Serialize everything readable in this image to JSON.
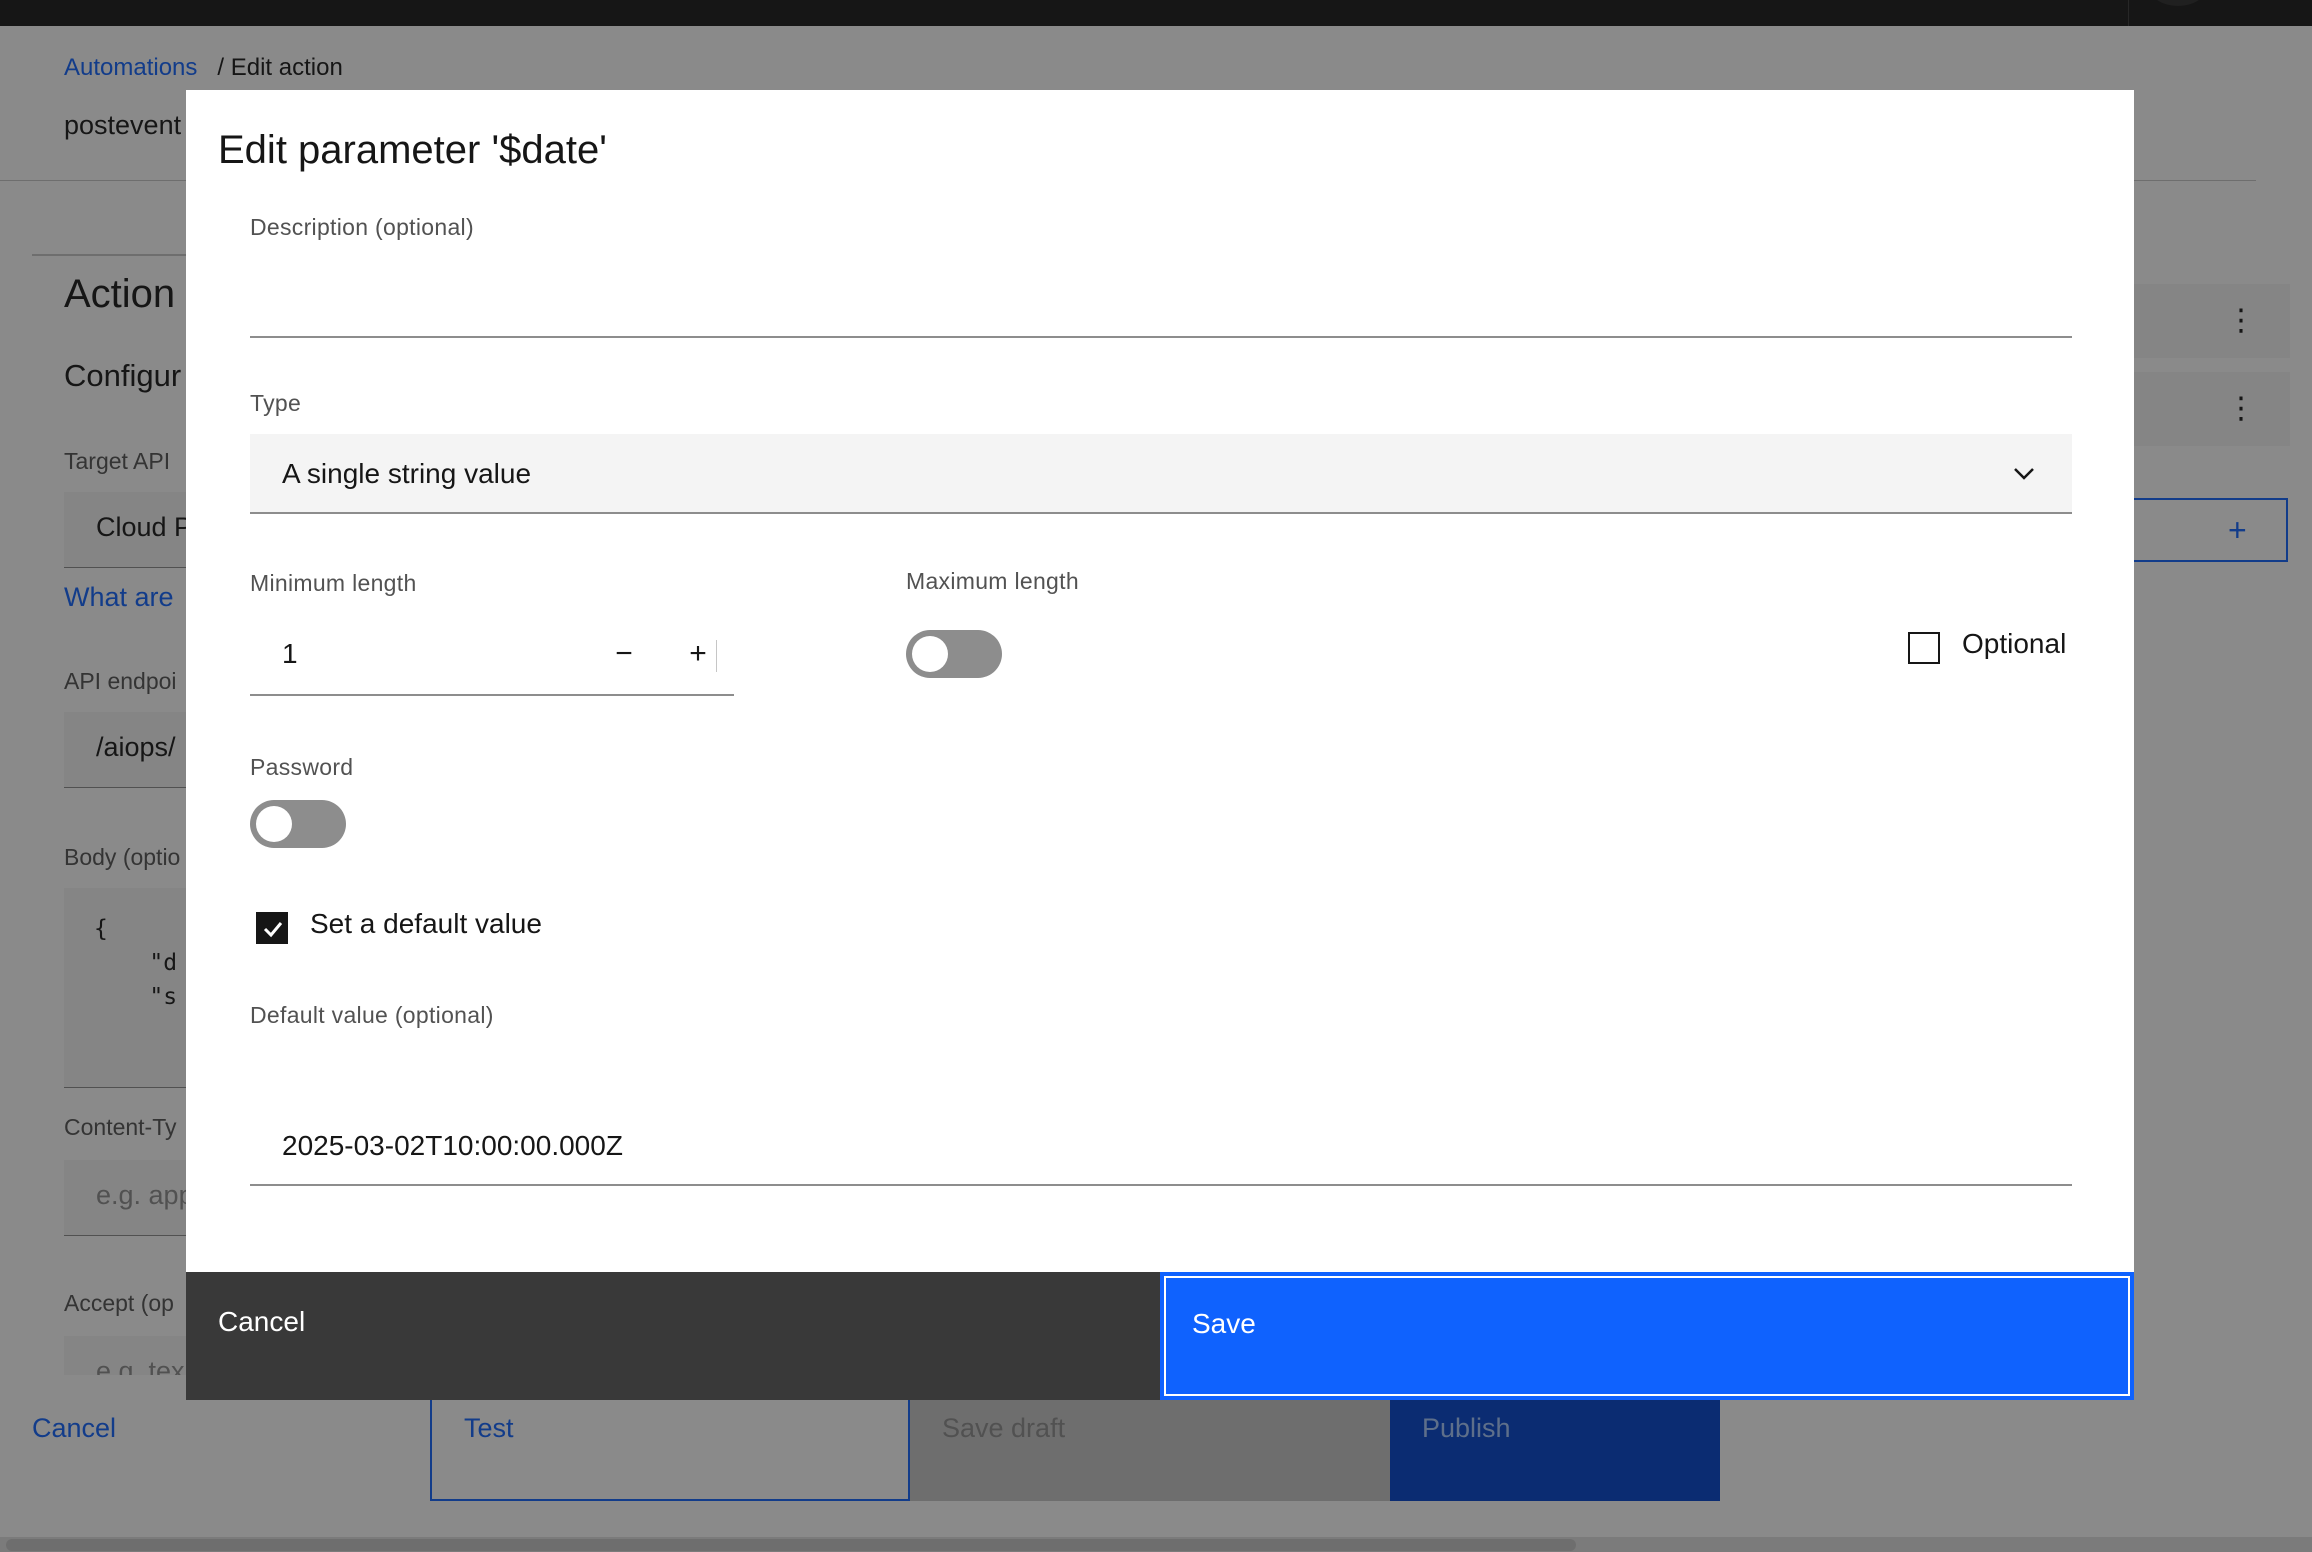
{
  "background": {
    "breadcrumb": {
      "root": "Automations",
      "current": "/ Edit action"
    },
    "page_title": "postevent",
    "section_title": "Action",
    "subsection_title": "Configur",
    "fields": {
      "target_api_label": "Target API",
      "target_api_value": "Cloud P",
      "help_link": "What are",
      "endpoint_label": "API endpoi",
      "endpoint_value": "/aiops/",
      "body_label": "Body (optio",
      "body_code": "{\n    \"d\n    \"s",
      "content_type_label": "Content-Ty",
      "content_type_placeholder": "e.g. app",
      "accept_label": "Accept (op",
      "accept_placeholder": "e.g. tex"
    },
    "right_panel": {
      "kebab": "⋮",
      "add": "+"
    },
    "footer": {
      "cancel": "Cancel",
      "test": "Test",
      "save_draft": "Save draft",
      "publish": "Publish"
    }
  },
  "modal": {
    "title": "Edit parameter '$date'",
    "description_label": "Description (optional)",
    "description_value": "",
    "type_label": "Type",
    "type_value": "A single string value",
    "min_length_label": "Minimum length",
    "min_length_value": "1",
    "decrement": "−",
    "increment": "+",
    "max_length_label": "Maximum length",
    "max_length_toggle_on": false,
    "optional_label": "Optional",
    "optional_checked": false,
    "password_label": "Password",
    "password_toggle_on": false,
    "set_default_label": "Set a default value",
    "set_default_checked": true,
    "default_value_label": "Default value (optional)",
    "default_value": "2025-03-02T10:00:00.000Z",
    "cancel_label": "Cancel",
    "save_label": "Save"
  },
  "colors": {
    "primary": "#0f62fe",
    "secondary_button": "#393939",
    "toggle_off": "#8d8d8d",
    "overlay": "rgba(22,22,22,0.5)"
  },
  "icons": {
    "dropdown": "chevron-down-icon",
    "checkbox_checked": "checkmark-icon",
    "row_menu": "overflow-menu-vertical-icon",
    "add": "add-icon"
  }
}
